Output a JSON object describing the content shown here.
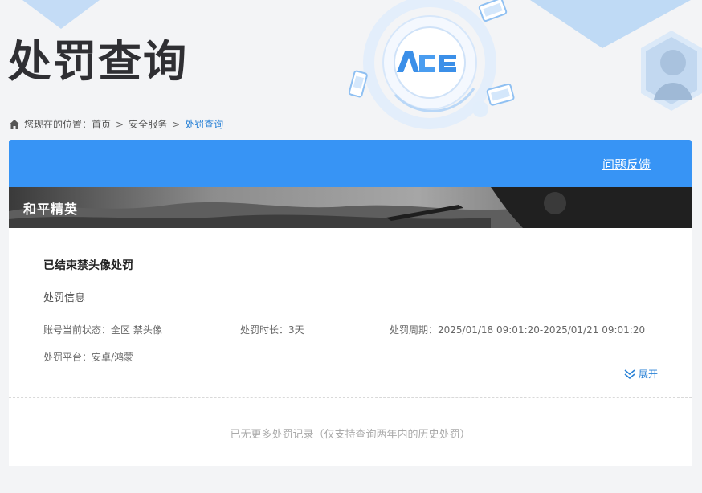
{
  "page": {
    "title": "处罚查询"
  },
  "breadcrumb": {
    "prefix": "您现在的位置：",
    "items": [
      "首页",
      "安全服务"
    ],
    "current": "处罚查询",
    "separator": ">"
  },
  "header": {
    "feedback_label": "问题反馈",
    "bar_color": "#3794f5"
  },
  "game": {
    "name": "和平精英"
  },
  "record": {
    "title": "已结束禁头像处罚",
    "info_heading": "处罚信息",
    "status_label": "账号当前状态：",
    "status_value": "全区 禁头像",
    "duration_label": "处罚时长：",
    "duration_value": "3天",
    "period_label": "处罚周期：",
    "period_value": "2025/01/18 09:01:20-2025/01/21 09:01:20",
    "platform_label": "处罚平台：",
    "platform_value": "安卓/鸿蒙",
    "expand_label": "展开"
  },
  "footer": {
    "no_more_text": "已无更多处罚记录（仅支持查询两年内的历史处罚）"
  },
  "icons": {
    "home": "home-icon",
    "expand": "double-chevron-down-icon",
    "logo": "ace-logo-icon"
  }
}
